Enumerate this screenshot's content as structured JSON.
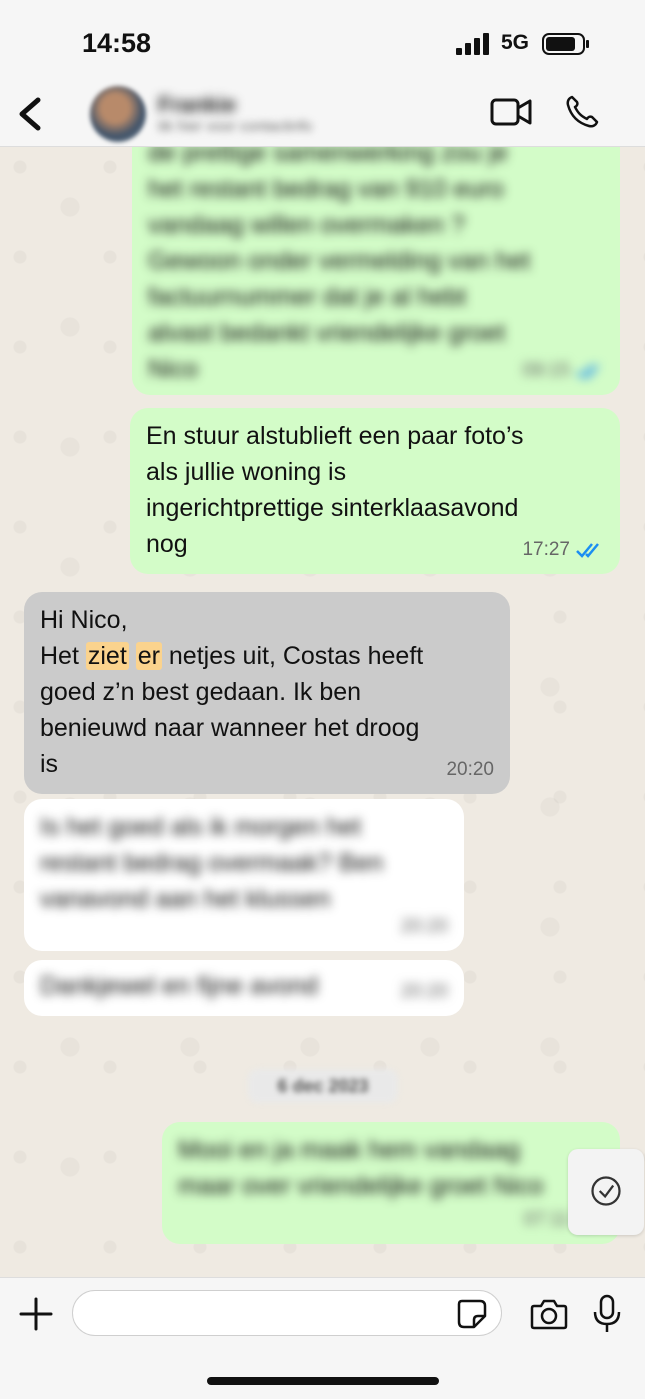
{
  "status_bar": {
    "time": "14:58",
    "network": "5G"
  },
  "header": {
    "contact_name": "Frankie",
    "contact_subtitle": "tik hier voor contactinfo"
  },
  "messages": [
    {
      "type": "outgoing",
      "blurred": true,
      "text": "de prettige samenwerking zou je\nhet restant bedrag van 910 euro\nvandaag willen overmaken ?\nGewoon onder vermelding van het\nfactuurnummer dat je al hebt\nalvast bedankt vriendelijke groet\nNico",
      "time": "09:15",
      "status": "read"
    },
    {
      "type": "outgoing",
      "blurred": false,
      "text": "En stuur alstublieft een paar foto’s\nals jullie woning is\ningerichtprettige sinterklaasavond\nnog",
      "time": "17:27",
      "status": "read"
    },
    {
      "type": "incoming",
      "blurred": false,
      "greeting": "Hi Nico,",
      "line2_start": "Het ",
      "hl_1": "ziet",
      "hl_2": "er",
      "line2_end": " netjes uit, Costas heeft",
      "rest": "goed z’n best gedaan. Ik ben\nbenieuwd naar wanneer het droog\nis",
      "time": "20:20"
    },
    {
      "type": "incoming",
      "blurred": true,
      "text": "Is het goed als ik morgen het\nrestant bedrag overmaak? Ben\nvanavond aan het klussen",
      "time": "20:20"
    },
    {
      "type": "incoming",
      "blurred": true,
      "text": "Dankjewel en fijne avond",
      "time": "20:20"
    },
    {
      "type": "outgoing",
      "blurred": true,
      "text": "Mooi en ja maak hem vandaag\nmaar over vriendelijke groet Nico",
      "time": "07:11",
      "status": "read"
    }
  ],
  "date_separator": "6 dec 2023",
  "input": {
    "placeholder": ""
  },
  "colors": {
    "outgoing_bubble": "#d3fcc8",
    "incoming_gray_bubble": "#cbcbcb",
    "incoming_white_bubble": "#ffffff",
    "read_ticks": "#1b8ef2",
    "highlight": "#fbd38d",
    "chat_background": "#efeae2"
  },
  "icons": {
    "back": "chevron-left-icon",
    "video": "video-camera-icon",
    "call": "phone-icon",
    "plus": "plus-icon",
    "sticker": "sticker-icon",
    "camera": "camera-icon",
    "mic": "microphone-icon",
    "ticks": "double-check-icon",
    "scroll": "scroll-down-icon"
  }
}
